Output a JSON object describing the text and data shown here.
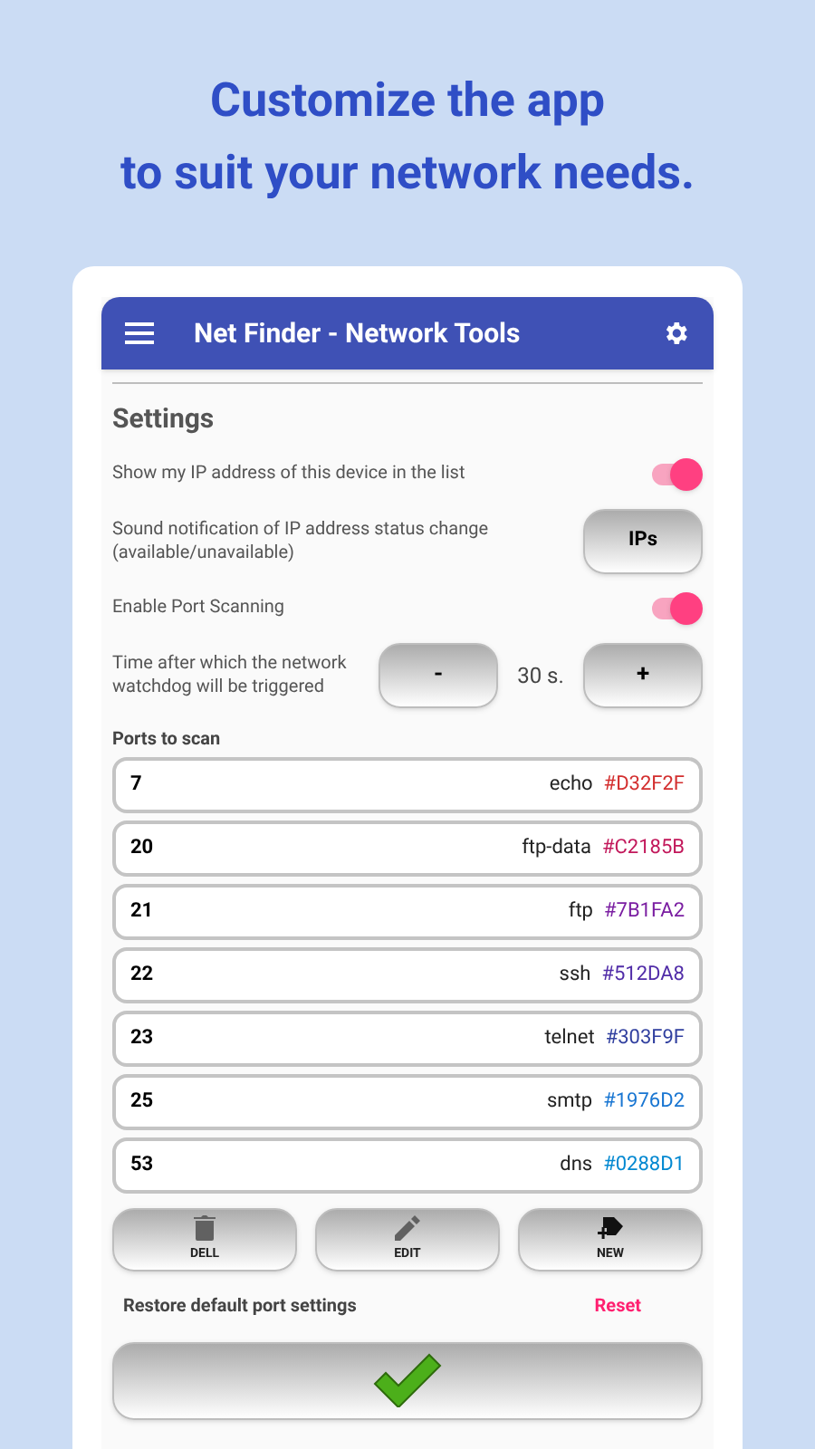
{
  "headline": [
    "Customize the app",
    "to suit your network needs."
  ],
  "app_bar": {
    "title": "Net Finder - Network Tools"
  },
  "settings": {
    "title": "Settings",
    "rows": [
      {
        "kind": "switch",
        "label": "Show my IP address of this device in the list",
        "on": true
      },
      {
        "kind": "button",
        "label": "Sound notification of IP address status change (available/unavailable)",
        "button": "IPs"
      },
      {
        "kind": "switch",
        "label": "Enable Port Scanning",
        "on": true
      },
      {
        "kind": "stepper",
        "label": "Time after which the network watchdog will be triggered",
        "minus": "-",
        "value": "30 s.",
        "plus": "+"
      }
    ]
  },
  "ports": {
    "title": "Ports to scan",
    "items": [
      {
        "port": "7",
        "name": "echo",
        "code": "#D32F2F",
        "color": "#d32f2f"
      },
      {
        "port": "20",
        "name": "ftp-data",
        "code": "#C2185B",
        "color": "#c2185b"
      },
      {
        "port": "21",
        "name": "ftp",
        "code": "#7B1FA2",
        "color": "#7b1fa2"
      },
      {
        "port": "22",
        "name": "ssh",
        "code": "#512DA8",
        "color": "#512da8"
      },
      {
        "port": "23",
        "name": "telnet",
        "code": "#303F9F",
        "color": "#303f9f"
      },
      {
        "port": "25",
        "name": "smtp",
        "code": "#1976D2",
        "color": "#1976d2"
      },
      {
        "port": "53",
        "name": "dns",
        "code": "#0288D1",
        "color": "#0288d1"
      }
    ]
  },
  "actions": [
    {
      "kind": "delete",
      "label": "DELL"
    },
    {
      "kind": "edit",
      "label": "EDIT"
    },
    {
      "kind": "new",
      "label": "NEW"
    }
  ],
  "restore": {
    "label": "Restore default port settings",
    "link": "Reset"
  }
}
